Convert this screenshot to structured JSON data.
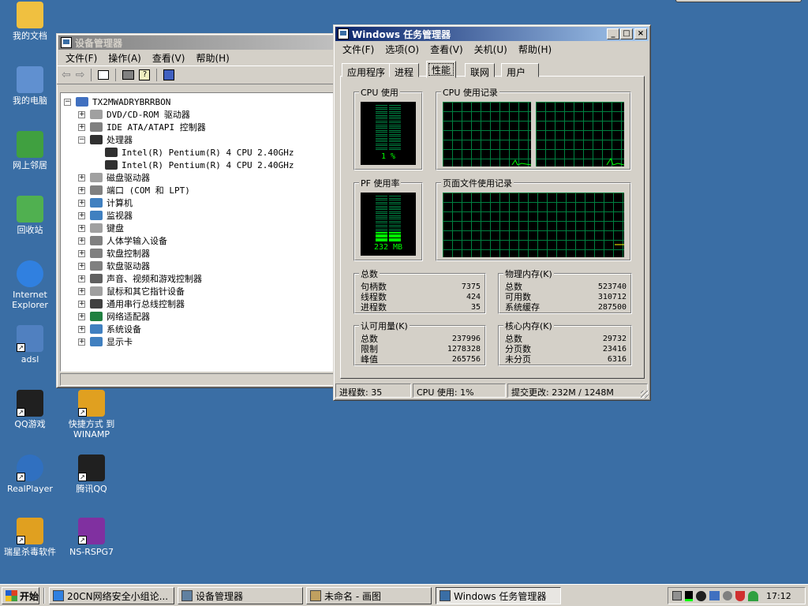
{
  "desktop_icons": [
    {
      "label": "我的文档",
      "color": "#f0c040"
    },
    {
      "label": "我的电脑",
      "color": "#6090d0"
    },
    {
      "label": "网上邻居",
      "color": "#40a040"
    },
    {
      "label": "回收站",
      "color": "#50b050"
    },
    {
      "label": "Internet Explorer",
      "color": "#3080e0"
    },
    {
      "label": "adsl",
      "color": "#5080c0"
    },
    {
      "label": "QQ游戏",
      "color": "#202020"
    },
    {
      "label": "快捷方式 到 WINAMP",
      "color": "#e0a020"
    },
    {
      "label": "RealPlayer",
      "color": "#3070c0"
    },
    {
      "label": "腾讯QQ",
      "color": "#202020"
    },
    {
      "label": "瑞星杀毒软件",
      "color": "#e0a020"
    },
    {
      "label": "NS-RSPG7",
      "color": "#8030a0"
    }
  ],
  "device_manager": {
    "title": "设备管理器",
    "menu": [
      "文件(F)",
      "操作(A)",
      "查看(V)",
      "帮助(H)"
    ],
    "tree": [
      {
        "label": "TX2MWADRYBRRBON",
        "toggle": "−"
      },
      {
        "label": "DVD/CD-ROM 驱动器",
        "toggle": "+"
      },
      {
        "label": "IDE ATA/ATAPI 控制器",
        "toggle": "+"
      },
      {
        "label": "处理器",
        "toggle": "−"
      },
      {
        "label": "Intel(R) Pentium(R) 4 CPU 2.40GHz",
        "toggle": ""
      },
      {
        "label": "Intel(R) Pentium(R) 4 CPU 2.40GHz",
        "toggle": ""
      },
      {
        "label": "磁盘驱动器",
        "toggle": "+"
      },
      {
        "label": "端口 (COM 和 LPT)",
        "toggle": "+"
      },
      {
        "label": "计算机",
        "toggle": "+"
      },
      {
        "label": "监视器",
        "toggle": "+"
      },
      {
        "label": "键盘",
        "toggle": "+"
      },
      {
        "label": "人体学输入设备",
        "toggle": "+"
      },
      {
        "label": "软盘控制器",
        "toggle": "+"
      },
      {
        "label": "软盘驱动器",
        "toggle": "+"
      },
      {
        "label": "声音、视频和游戏控制器",
        "toggle": "+"
      },
      {
        "label": "鼠标和其它指针设备",
        "toggle": "+"
      },
      {
        "label": "通用串行总线控制器",
        "toggle": "+"
      },
      {
        "label": "网络适配器",
        "toggle": "+"
      },
      {
        "label": "系统设备",
        "toggle": "+"
      },
      {
        "label": "显示卡",
        "toggle": "+"
      }
    ]
  },
  "task_manager": {
    "title": "Windows 任务管理器",
    "menu": [
      "文件(F)",
      "选项(O)",
      "查看(V)",
      "关机(U)",
      "帮助(H)"
    ],
    "tabs": [
      "应用程序",
      "进程",
      "性能",
      "联网",
      "用户"
    ],
    "active_tab": "性能",
    "cpu_usage": {
      "title": "CPU 使用",
      "value": "1 %",
      "fraction": 0.01
    },
    "cpu_history": {
      "title": "CPU 使用记录"
    },
    "pf_usage": {
      "title": "PF 使用率",
      "value": "232 MB",
      "fraction": 0.19
    },
    "pf_history": {
      "title": "页面文件使用记录"
    },
    "totals": {
      "title": "总数",
      "rows": [
        {
          "label": "句柄数",
          "value": "7375"
        },
        {
          "label": "线程数",
          "value": "424"
        },
        {
          "label": "进程数",
          "value": "35"
        }
      ]
    },
    "physical_memory": {
      "title": "物理内存(K)",
      "rows": [
        {
          "label": "总数",
          "value": "523740"
        },
        {
          "label": "可用数",
          "value": "310712"
        },
        {
          "label": "系统缓存",
          "value": "287500"
        }
      ]
    },
    "commit_charge": {
      "title": "认可用量(K)",
      "rows": [
        {
          "label": "总数",
          "value": "237996"
        },
        {
          "label": "限制",
          "value": "1278328"
        },
        {
          "label": "峰值",
          "value": "265756"
        }
      ]
    },
    "kernel_memory": {
      "title": "核心内存(K)",
      "rows": [
        {
          "label": "总数",
          "value": "29732"
        },
        {
          "label": "分页数",
          "value": "23416"
        },
        {
          "label": "未分页",
          "value": "6316"
        }
      ]
    },
    "status": {
      "processes": "进程数: 35",
      "cpu": "CPU 使用: 1%",
      "commit": "提交更改: 232M / 1248M"
    }
  },
  "taskbar": {
    "start_label": "开始",
    "buttons": [
      "20CN网络安全小组论...",
      "设备管理器",
      "未命名 - 画图",
      "Windows 任务管理器"
    ],
    "clock": "17:12"
  },
  "colors": {
    "desktop": "#3a6ea5",
    "title_active": "#0a246a",
    "graph_grid": "#008040",
    "graph_line": "#00ff00"
  }
}
